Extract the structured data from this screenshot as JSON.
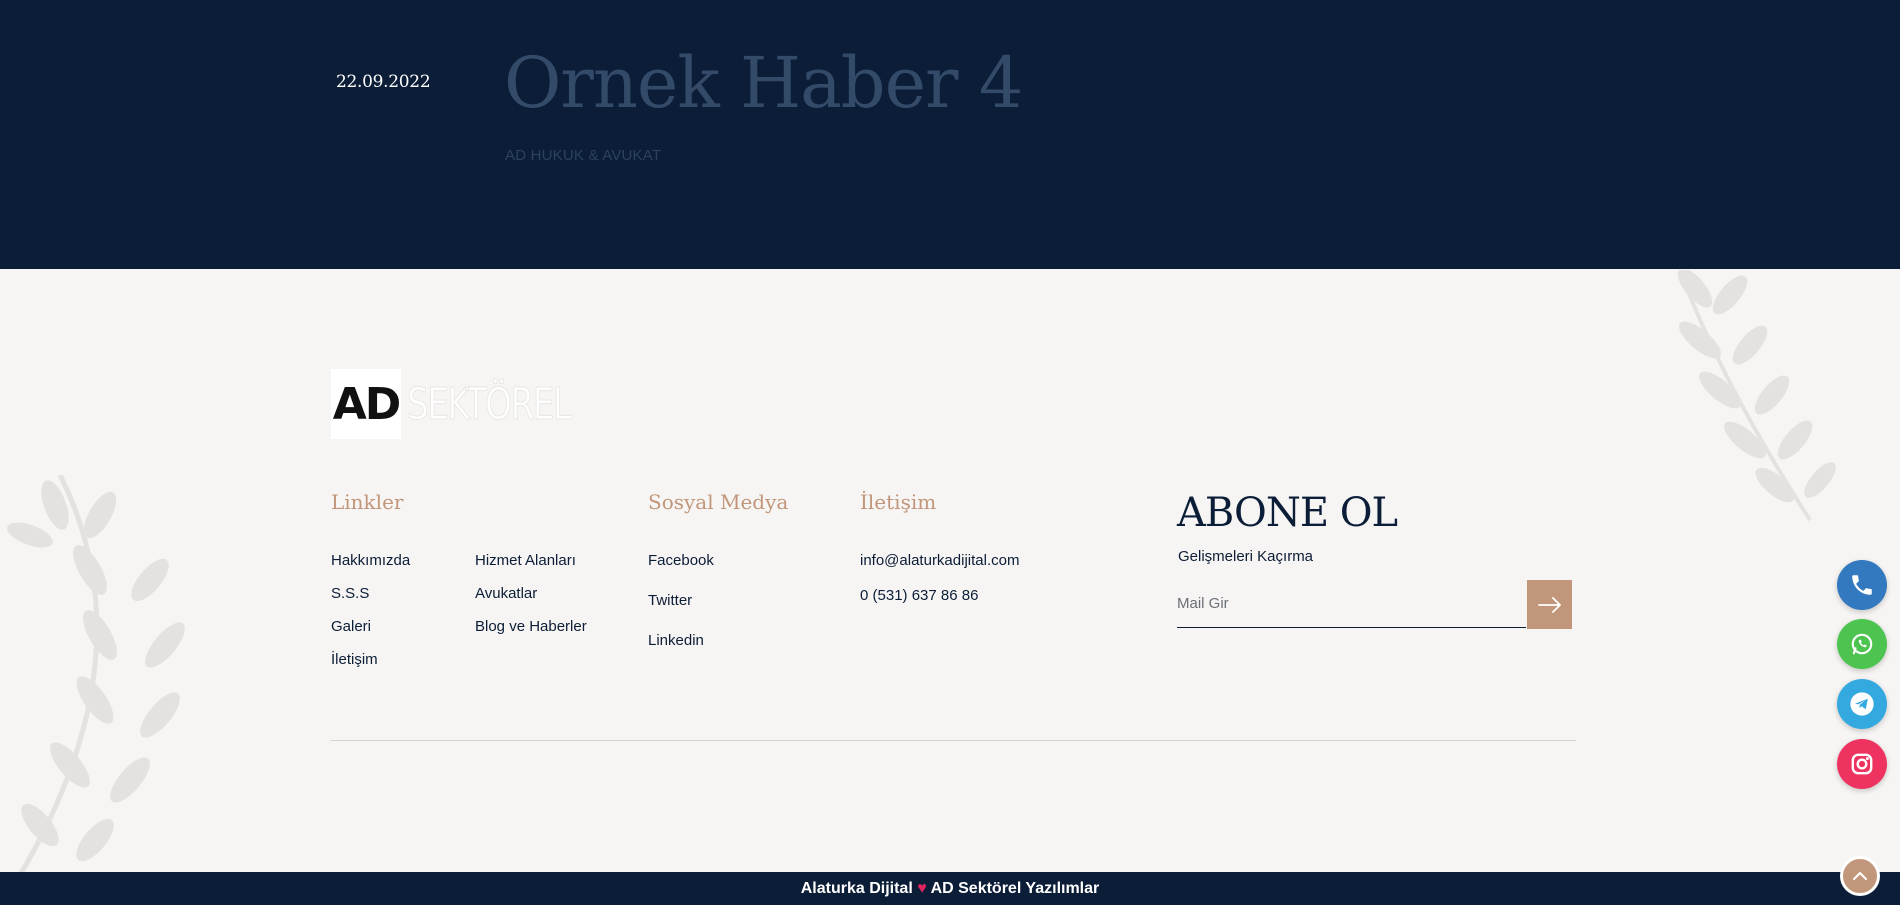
{
  "hero": {
    "date": "22.09.2022",
    "title": "Ornek Haber 4",
    "subtitle": "AD HUKUK & AVUKAT"
  },
  "logo": {
    "box_text": "AD",
    "text": "SEKTÖREL"
  },
  "footer": {
    "linkler": {
      "title": "Linkler",
      "col1": [
        "Hakkımızda",
        "S.S.S",
        "Galeri",
        "İletişim"
      ],
      "col2": [
        "Hizmet Alanları",
        "Avukatlar",
        "Blog ve Haberler"
      ]
    },
    "sosyal": {
      "title": "Sosyal Medya",
      "items": [
        "Facebook",
        "Twitter",
        "Linkedin"
      ]
    },
    "iletisim": {
      "title": "İletişim",
      "email": "info@alaturkadijital.com",
      "phone": "0 (531) 637 86 86"
    },
    "abone": {
      "title": "ABONE OL",
      "subtitle": "Gelişmeleri Kaçırma",
      "placeholder": "Mail Gir"
    }
  },
  "credit": {
    "left": "Alaturka Dijital",
    "right": "AD Sektörel Yazılımlar"
  },
  "colors": {
    "navy": "#0b1d37",
    "accent": "#c1967a",
    "phone": "#3379c0",
    "whatsapp": "#4cc44f",
    "telegram": "#34a9e0",
    "instagram": "#ee3360"
  },
  "floating_buttons": [
    "phone-icon",
    "whatsapp-icon",
    "telegram-icon",
    "instagram-icon"
  ]
}
